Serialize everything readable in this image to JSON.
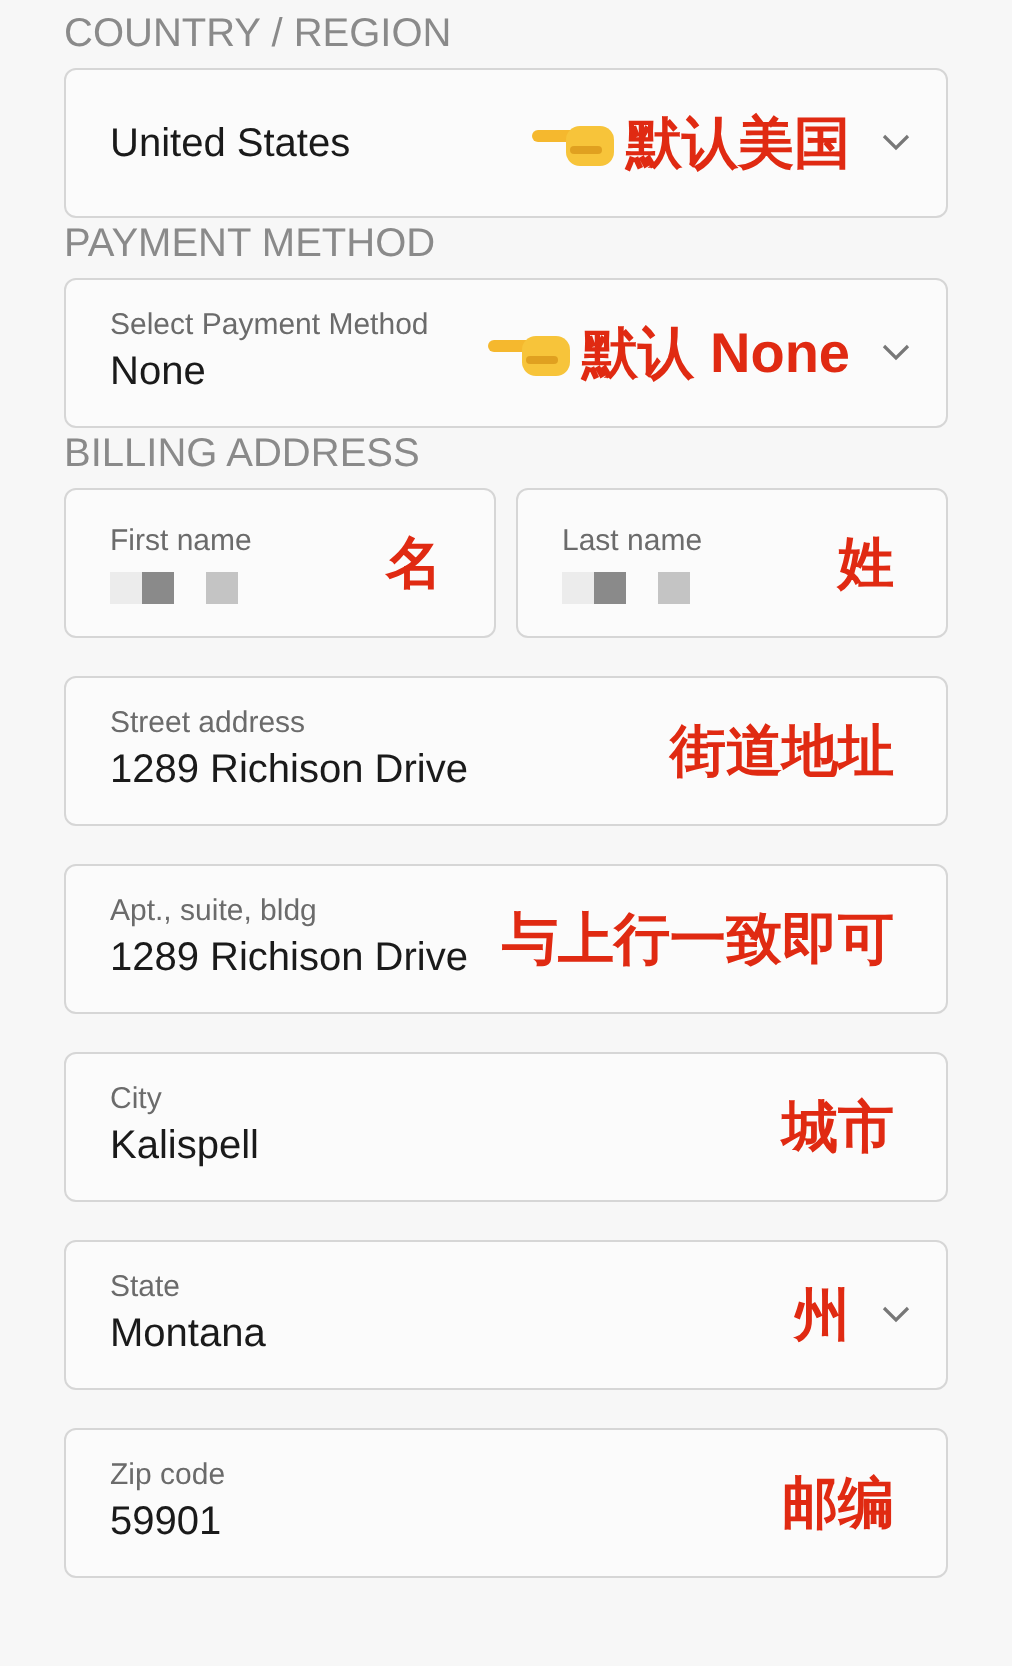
{
  "sections": [
    {
      "heading": "COUNTRY / REGION",
      "rows": [
        [
          {
            "kind": "select",
            "value": "United States",
            "annotation": "默认美国",
            "pointer": true
          }
        ]
      ]
    },
    {
      "heading": "PAYMENT METHOD",
      "rows": [
        [
          {
            "kind": "select",
            "label": "Select Payment Method",
            "value": "None",
            "annotation": "默认 None",
            "pointer": true
          }
        ]
      ]
    },
    {
      "heading": "BILLING ADDRESS",
      "rows": [
        [
          {
            "kind": "redacted",
            "label": "First name",
            "annotation": "名",
            "pointer": false
          },
          {
            "kind": "redacted",
            "label": "Last name",
            "annotation": "姓",
            "pointer": false
          }
        ],
        [
          {
            "kind": "text",
            "label": "Street address",
            "value": "1289 Richison Drive",
            "annotation": "街道地址",
            "pointer": false
          }
        ],
        [
          {
            "kind": "text",
            "label": "Apt., suite, bldg",
            "value": "1289 Richison Drive",
            "annotation": "与上行一致即可",
            "pointer": false
          }
        ],
        [
          {
            "kind": "text",
            "label": "City",
            "value": "Kalispell",
            "annotation": "城市",
            "pointer": false
          }
        ],
        [
          {
            "kind": "select",
            "label": "State",
            "value": "Montana",
            "annotation": "州",
            "pointer": false
          }
        ],
        [
          {
            "kind": "text",
            "label": "Zip code",
            "value": "59901",
            "annotation": "邮编",
            "pointer": false
          }
        ]
      ]
    }
  ]
}
